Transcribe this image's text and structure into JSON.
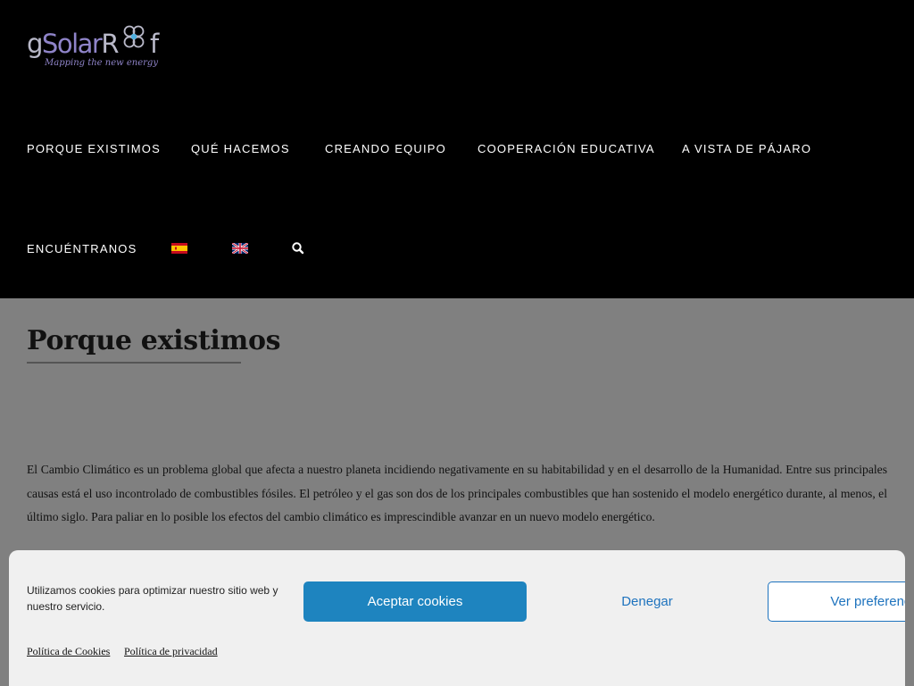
{
  "header": {
    "logo": {
      "prefix": "g",
      "solar": "Solar",
      "r": "R",
      "suffix": "f",
      "tagline": "Mapping the new energy"
    },
    "nav": [
      {
        "label": "PORQUE EXISTIMOS"
      },
      {
        "label": "QUÉ HACEMOS"
      },
      {
        "label": "CREANDO EQUIPO"
      },
      {
        "label": "COOPERACIÓN EDUCATIVA"
      },
      {
        "label": "A VISTA DE PÁJARO"
      },
      {
        "label": "ENCUÉNTRANOS"
      }
    ],
    "languages": [
      {
        "icon": "spain-flag-icon"
      },
      {
        "icon": "uk-flag-icon"
      }
    ],
    "search_icon": "search-icon"
  },
  "main": {
    "title": "Porque existimos",
    "paragraph": "El Cambio Climático es un problema global que afecta a nuestro planeta incidiendo negativamente en su habitabilidad y en el desarrollo de la Humanidad. Entre sus principales causas está el uso incontrolado de combustibles fósiles. El petróleo y el gas son dos de los principales combustibles que han sostenido el modelo energético durante, al menos, el último siglo. Para paliar en lo posible los efectos del cambio climático es imprescindible avanzar en un nuevo modelo energético."
  },
  "cookie_banner": {
    "message": "Utilizamos cookies para optimizar nuestro sitio web y nuestro servicio.",
    "accept_label": "Aceptar cookies",
    "deny_label": "Denegar",
    "preferences_label": "Ver preferencias",
    "cookie_policy_link": "Política de Cookies",
    "privacy_policy_link": "Política de privacidad"
  },
  "colors": {
    "header_bg": "#000000",
    "page_bg": "#808080",
    "accent_button": "#1e84bf",
    "link_blue": "#1e73be",
    "logo_purple": "#8f84c9"
  }
}
